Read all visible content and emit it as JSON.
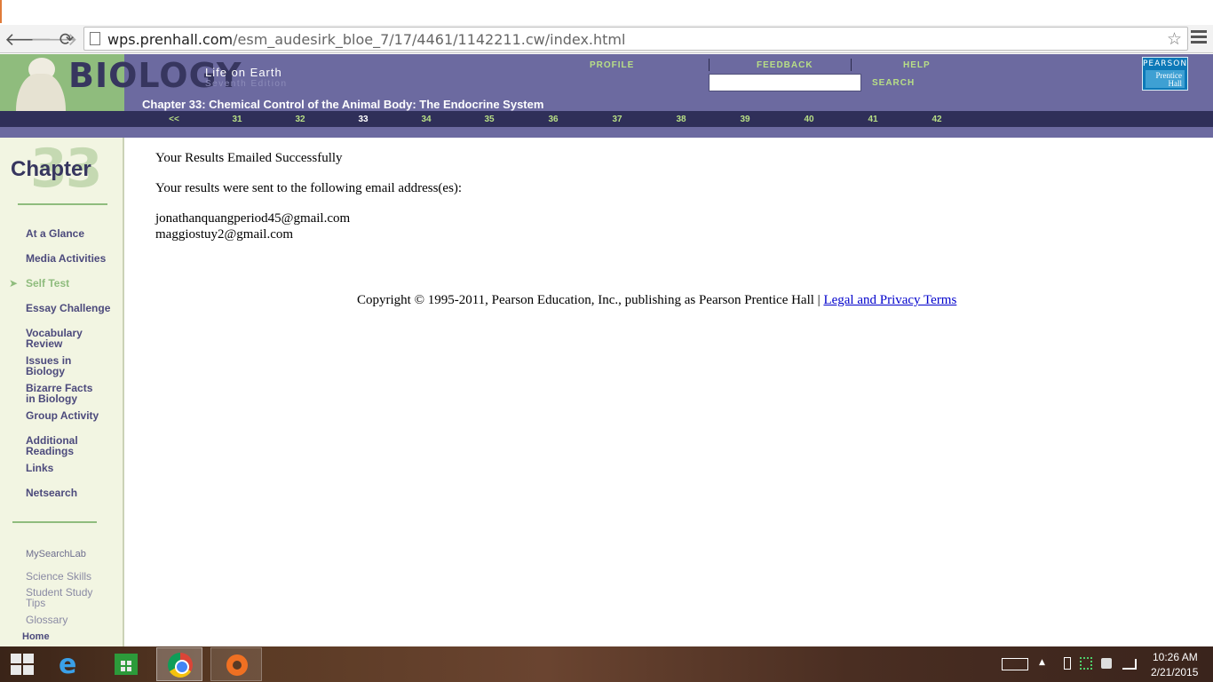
{
  "browser": {
    "url_host": "wps.prenhall.com",
    "url_path": "/esm_audesirk_bloe_7/17/4461/1142211.cw/index.html",
    "back_glyph": "🡐",
    "forward_glyph": "🡒",
    "reload_glyph": "⟳",
    "star_glyph": "☆"
  },
  "header": {
    "brand": "BIOLOGY",
    "subtitle": "Life on Earth",
    "edition": "Seventh Edition",
    "links": {
      "profile": "PROFILE",
      "feedback": "FEEDBACK",
      "help": "HELP",
      "search": "SEARCH"
    },
    "search_value": "",
    "publisher_top": "PEARSON",
    "publisher_bottom_1": "Prentice",
    "publisher_bottom_2": "Hall",
    "chapter_title": "Chapter 33: Chemical Control of the Animal Body: The Endocrine System",
    "chapter_nav": [
      "<<",
      "31",
      "32",
      "33",
      "34",
      "35",
      "36",
      "37",
      "38",
      "39",
      "40",
      "41",
      "42"
    ],
    "current_chapter": "33"
  },
  "sidebar": {
    "chapter_label": "Chapter",
    "chapter_number": "33",
    "active_arrow": "➤",
    "items": [
      "At a Glance",
      "Media Activities",
      "Self Test",
      "Essay Challenge",
      "Vocabulary Review",
      "Issues in Biology",
      "Bizarre Facts in Biology",
      "Group Activity",
      "Additional Readings",
      "Links",
      "Netsearch"
    ],
    "active_item": "Self Test",
    "sub_header": "MySearchLab",
    "sub_items": [
      "Science Skills",
      "Student Study Tips",
      "Glossary"
    ],
    "home": "Home"
  },
  "main": {
    "heading": "Your Results Emailed Successfully",
    "intro": "Your results were sent to the following email address(es):",
    "emails": [
      "jonathanquangperiod45@gmail.com",
      "maggiostuy2@gmail.com"
    ],
    "copyright": "Copyright © 1995-2011, Pearson Education, Inc., publishing as Pearson Prentice Hall |",
    "legal_link": "Legal and Privacy Terms"
  },
  "taskbar": {
    "ie_glyph": "e",
    "tray_up": "▲",
    "time": "10:26 AM",
    "date": "2/21/2015"
  },
  "colors": {
    "header_purple": "#6c6aa0",
    "nav_green": "#b8df86",
    "sidebar_bg": "#f2f5e2"
  }
}
